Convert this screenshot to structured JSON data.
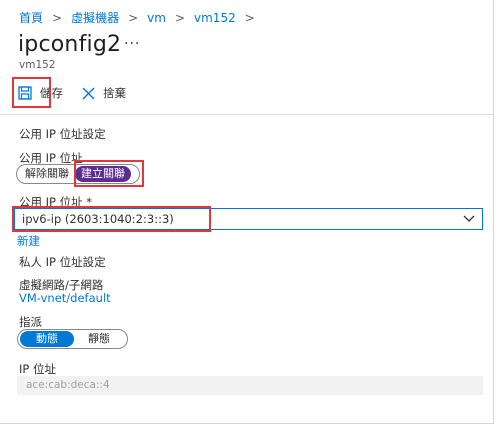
{
  "breadcrumb": [
    "首頁",
    "虛擬機器",
    "vm",
    "vm152"
  ],
  "page": {
    "title": "ipconfig2",
    "more": "···",
    "subtitle": "vm152"
  },
  "toolbar": {
    "save_label": "儲存",
    "discard_label": "捨棄"
  },
  "public_ip_settings": {
    "heading": "公用 IP 位址設定",
    "toggle_label": "公用 IP 位址",
    "toggle_options": [
      "解除關聯",
      "建立關聯"
    ],
    "selected": "建立關聯",
    "select_label": "公用 IP 位址",
    "required_mark": "*",
    "selected_ip": "ipv6-ip (2603:1040:2:3::3)",
    "new_link": "新建"
  },
  "private_ip_settings": {
    "heading": "私人 IP 位址設定",
    "vnet_label": "虛擬網路/子網路",
    "vnet_value": "VM-vnet/default",
    "assignment_label": "指派",
    "assignment_options": [
      "動態",
      "靜態"
    ],
    "assignment_selected": "動態",
    "ip_label": "IP 位址",
    "ip_value": "ace:cab:deca::4"
  },
  "colors": {
    "accent": "#0078d4",
    "selected_toggle": "#5c2d91",
    "highlight": "#e0363c"
  }
}
